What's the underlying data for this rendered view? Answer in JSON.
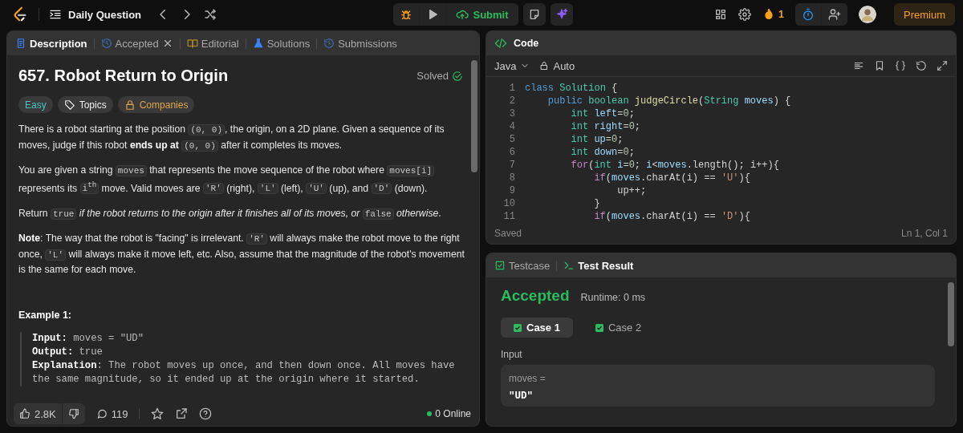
{
  "top_bar": {
    "problem_list": "Daily Question",
    "streak": "1",
    "premium": "Premium",
    "submit": "Submit"
  },
  "description_panel": {
    "tabs": [
      {
        "label": "Description",
        "selected": true,
        "closable": false
      },
      {
        "label": "Accepted",
        "selected": false,
        "closable": true
      },
      {
        "label": "Editorial",
        "selected": false,
        "closable": false
      },
      {
        "label": "Solutions",
        "selected": false,
        "closable": false
      },
      {
        "label": "Submissions",
        "selected": false,
        "closable": false
      }
    ],
    "title": "657. Robot Return to Origin",
    "status": "Solved",
    "tags": [
      {
        "kind": "difficulty",
        "label": "Easy"
      },
      {
        "kind": "topics",
        "label": "Topics"
      },
      {
        "kind": "companies",
        "label": "Companies"
      }
    ],
    "paragraphs": [
      [
        {
          "kind": "text",
          "text": "There is a robot starting at the position "
        },
        {
          "kind": "code",
          "text": "(0, 0)"
        },
        {
          "kind": "text",
          "text": ", the origin, on a 2D plane. Given a sequence of its moves, judge if this robot "
        },
        {
          "kind": "bold",
          "text": "ends up at "
        },
        {
          "kind": "code",
          "text": "(0, 0)"
        },
        {
          "kind": "text",
          "text": " after it completes its moves."
        }
      ],
      [
        {
          "kind": "text",
          "text": "You are given a string "
        },
        {
          "kind": "code",
          "text": "moves"
        },
        {
          "kind": "text",
          "text": " that represents the move sequence of the robot where "
        },
        {
          "kind": "code",
          "text": "moves[i]"
        },
        {
          "kind": "text",
          "text": " represents its "
        },
        {
          "kind": "code",
          "text": "i$^{th}$"
        },
        {
          "kind": "text",
          "text": " move. Valid moves are "
        },
        {
          "kind": "code",
          "text": "'R'"
        },
        {
          "kind": "text",
          "text": " (right), "
        },
        {
          "kind": "code",
          "text": "'L'"
        },
        {
          "kind": "text",
          "text": " (left), "
        },
        {
          "kind": "code",
          "text": "'U'"
        },
        {
          "kind": "text",
          "text": " (up), and "
        },
        {
          "kind": "code",
          "text": "'D'"
        },
        {
          "kind": "text",
          "text": " (down)."
        }
      ],
      [
        {
          "kind": "text",
          "text": "Return "
        },
        {
          "kind": "code",
          "text": "true"
        },
        {
          "kind": "italic",
          "text": " if the robot returns to the origin after it finishes all of its moves, or "
        },
        {
          "kind": "code",
          "text": "false"
        },
        {
          "kind": "italic",
          "text": " otherwise"
        },
        {
          "kind": "text",
          "text": "."
        }
      ],
      [
        {
          "kind": "bold",
          "text": "Note"
        },
        {
          "kind": "text",
          "text": ": The way that the robot is \"facing\" is irrelevant. "
        },
        {
          "kind": "code",
          "text": "'R'"
        },
        {
          "kind": "text",
          "text": " will always make the robot move to the right once, "
        },
        {
          "kind": "code",
          "text": "'L'"
        },
        {
          "kind": "text",
          "text": " will always make it move left, etc. Also, assume that the magnitude of the robot's movement is the same for each move."
        }
      ]
    ],
    "example": {
      "heading": "Example 1:",
      "lines": [
        {
          "label": "Input:",
          "value": " moves = \"UD\""
        },
        {
          "label": "Output:",
          "value": " true"
        },
        {
          "label": "Explanation",
          "value": ": The robot moves up once, and then down once. All moves have the same magnitude, so it ended up at the origin where it started."
        }
      ]
    },
    "footer": {
      "likes": "2.8K",
      "comments": "119",
      "online": "0 Online"
    }
  },
  "code_panel": {
    "title": "Code",
    "language": "Java",
    "mode": "Auto",
    "lines": [
      {
        "number": "1",
        "tokens": [
          {
            "kind": "keyword",
            "text": "class "
          },
          {
            "kind": "type",
            "text": "Solution"
          },
          {
            "kind": "plain",
            "text": " {"
          }
        ]
      },
      {
        "number": "2",
        "tokens": [
          {
            "kind": "keyword",
            "text": "    public "
          },
          {
            "kind": "type",
            "text": "boolean "
          },
          {
            "kind": "function",
            "text": "judgeCircle"
          },
          {
            "kind": "plain",
            "text": "("
          },
          {
            "kind": "type",
            "text": "String "
          },
          {
            "kind": "variable",
            "text": "moves"
          },
          {
            "kind": "plain",
            "text": ") {"
          }
        ]
      },
      {
        "number": "3",
        "tokens": [
          {
            "kind": "type",
            "text": "        int "
          },
          {
            "kind": "variable",
            "text": "left"
          },
          {
            "kind": "plain",
            "text": "="
          },
          {
            "kind": "number",
            "text": "0"
          },
          {
            "kind": "plain",
            "text": ";"
          }
        ]
      },
      {
        "number": "4",
        "tokens": [
          {
            "kind": "type",
            "text": "        int "
          },
          {
            "kind": "variable",
            "text": "right"
          },
          {
            "kind": "plain",
            "text": "="
          },
          {
            "kind": "number",
            "text": "0"
          },
          {
            "kind": "plain",
            "text": ";"
          }
        ]
      },
      {
        "number": "5",
        "tokens": [
          {
            "kind": "type",
            "text": "        int "
          },
          {
            "kind": "variable",
            "text": "up"
          },
          {
            "kind": "plain",
            "text": "="
          },
          {
            "kind": "number",
            "text": "0"
          },
          {
            "kind": "plain",
            "text": ";"
          }
        ]
      },
      {
        "number": "6",
        "tokens": [
          {
            "kind": "type",
            "text": "        int "
          },
          {
            "kind": "variable",
            "text": "down"
          },
          {
            "kind": "plain",
            "text": "="
          },
          {
            "kind": "number",
            "text": "0"
          },
          {
            "kind": "plain",
            "text": ";"
          }
        ]
      },
      {
        "number": "7",
        "tokens": [
          {
            "kind": "control",
            "text": "        for"
          },
          {
            "kind": "plain",
            "text": "("
          },
          {
            "kind": "type",
            "text": "int "
          },
          {
            "kind": "variable",
            "text": "i"
          },
          {
            "kind": "plain",
            "text": "="
          },
          {
            "kind": "number",
            "text": "0"
          },
          {
            "kind": "plain",
            "text": "; "
          },
          {
            "kind": "variable",
            "text": "i"
          },
          {
            "kind": "plain",
            "text": "<"
          },
          {
            "kind": "variable",
            "text": "moves"
          },
          {
            "kind": "plain",
            "text": ".length(); i++){"
          }
        ]
      },
      {
        "number": "8",
        "tokens": [
          {
            "kind": "control",
            "text": "            if"
          },
          {
            "kind": "plain",
            "text": "("
          },
          {
            "kind": "variable",
            "text": "moves"
          },
          {
            "kind": "plain",
            "text": ".charAt(i) == "
          },
          {
            "kind": "string",
            "text": "'U'"
          },
          {
            "kind": "plain",
            "text": "){"
          }
        ]
      },
      {
        "number": "9",
        "tokens": [
          {
            "kind": "plain",
            "text": "                up++;"
          }
        ]
      },
      {
        "number": "10",
        "tokens": [
          {
            "kind": "plain",
            "text": "            }"
          }
        ]
      },
      {
        "number": "11",
        "tokens": [
          {
            "kind": "control",
            "text": "            if"
          },
          {
            "kind": "plain",
            "text": "("
          },
          {
            "kind": "variable",
            "text": "moves"
          },
          {
            "kind": "plain",
            "text": ".charAt(i) == "
          },
          {
            "kind": "string",
            "text": "'D'"
          },
          {
            "kind": "plain",
            "text": "){"
          }
        ]
      }
    ],
    "save_state": "Saved",
    "cursor": "Ln 1, Col 1"
  },
  "result_panel": {
    "tabs": [
      {
        "label": "Testcase",
        "selected": false
      },
      {
        "label": "Test Result",
        "selected": true
      }
    ],
    "verdict": "Accepted",
    "runtime": "Runtime: 0 ms",
    "cases": [
      {
        "label": "Case 1",
        "selected": true,
        "passed": true
      },
      {
        "label": "Case 2",
        "selected": false,
        "passed": true
      }
    ],
    "input_heading": "Input",
    "input_name": "moves =",
    "input_value": "\"UD\""
  }
}
